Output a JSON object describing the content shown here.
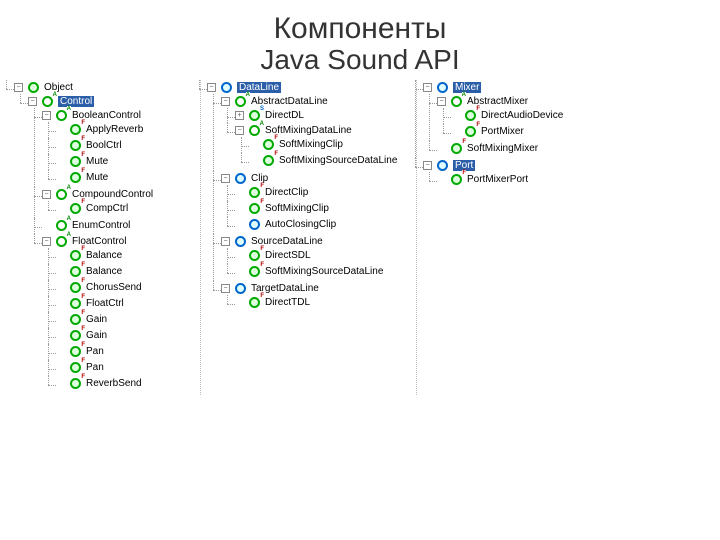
{
  "title": {
    "line1": "Компоненты",
    "line2": "Java Sound API"
  },
  "trees": [
    {
      "id": "col1",
      "root": {
        "label": "Object",
        "icon": "class",
        "toggle": "minus",
        "children": [
          {
            "label": "Control",
            "icon": "class-abstract",
            "badge": "A",
            "selected": true,
            "toggle": "minus",
            "children": [
              {
                "label": "BooleanControl",
                "icon": "class-abstract",
                "badge": "A",
                "toggle": "minus",
                "children": [
                  {
                    "label": "ApplyReverb",
                    "icon": "class",
                    "badge": "F"
                  },
                  {
                    "label": "BoolCtrl",
                    "icon": "class",
                    "badge": "F"
                  },
                  {
                    "label": "Mute",
                    "icon": "class",
                    "badge": "F"
                  },
                  {
                    "label": "Mute",
                    "icon": "class",
                    "badge": "F"
                  }
                ]
              },
              {
                "label": "CompoundControl",
                "icon": "class-abstract",
                "badge": "A",
                "toggle": "minus",
                "children": [
                  {
                    "label": "CompCtrl",
                    "icon": "class",
                    "badge": "F"
                  }
                ]
              },
              {
                "label": "EnumControl",
                "icon": "class-abstract",
                "badge": "A"
              },
              {
                "label": "FloatControl",
                "icon": "class-abstract",
                "badge": "A",
                "toggle": "minus",
                "children": [
                  {
                    "label": "Balance",
                    "icon": "class",
                    "badge": "F"
                  },
                  {
                    "label": "Balance",
                    "icon": "class",
                    "badge": "F"
                  },
                  {
                    "label": "ChorusSend",
                    "icon": "class",
                    "badge": "F"
                  },
                  {
                    "label": "FloatCtrl",
                    "icon": "class",
                    "badge": "F"
                  },
                  {
                    "label": "Gain",
                    "icon": "class",
                    "badge": "F"
                  },
                  {
                    "label": "Gain",
                    "icon": "class",
                    "badge": "F"
                  },
                  {
                    "label": "Pan",
                    "icon": "class",
                    "badge": "F"
                  },
                  {
                    "label": "Pan",
                    "icon": "class",
                    "badge": "F"
                  },
                  {
                    "label": "ReverbSend",
                    "icon": "class",
                    "badge": "F"
                  }
                ]
              }
            ]
          }
        ]
      }
    },
    {
      "id": "col2",
      "root": {
        "label": "DataLine",
        "icon": "interface",
        "selected": true,
        "toggle": "minus",
        "children": [
          {
            "label": "AbstractDataLine",
            "icon": "class-abstract",
            "badge": "A",
            "toggle": "minus",
            "children": [
              {
                "label": "DirectDL",
                "icon": "class",
                "badge": "S",
                "toggle": "plus"
              },
              {
                "label": "SoftMixingDataLine",
                "icon": "class-abstract",
                "badge": "A",
                "toggle": "minus",
                "children": [
                  {
                    "label": "SoftMixingClip",
                    "icon": "class",
                    "badge": "F"
                  },
                  {
                    "label": "SoftMixingSourceDataLine",
                    "icon": "class",
                    "badge": "F"
                  }
                ]
              }
            ]
          },
          {
            "label": "Clip",
            "icon": "interface",
            "toggle": "minus",
            "children": [
              {
                "label": "DirectClip",
                "icon": "class",
                "badge": "F"
              },
              {
                "label": "SoftMixingClip",
                "icon": "class",
                "badge": "F"
              },
              {
                "label": "AutoClosingClip",
                "icon": "interface"
              }
            ]
          },
          {
            "label": "SourceDataLine",
            "icon": "interface",
            "toggle": "minus",
            "children": [
              {
                "label": "DirectSDL",
                "icon": "class",
                "badge": "F"
              },
              {
                "label": "SoftMixingSourceDataLine",
                "icon": "class",
                "badge": "F"
              }
            ]
          },
          {
            "label": "TargetDataLine",
            "icon": "interface",
            "toggle": "minus",
            "children": [
              {
                "label": "DirectTDL",
                "icon": "class",
                "badge": "F"
              }
            ]
          }
        ]
      }
    },
    {
      "id": "col3",
      "roots": [
        {
          "label": "Mixer",
          "icon": "interface",
          "selected": true,
          "toggle": "minus",
          "children": [
            {
              "label": "AbstractMixer",
              "icon": "class-abstract",
              "badge": "A",
              "toggle": "minus",
              "children": [
                {
                  "label": "DirectAudioDevice",
                  "icon": "class",
                  "badge": "F"
                },
                {
                  "label": "PortMixer",
                  "icon": "class",
                  "badge": "F"
                }
              ]
            },
            {
              "label": "SoftMixingMixer",
              "icon": "class",
              "badge": "F"
            }
          ]
        },
        {
          "label": "Port",
          "icon": "interface",
          "selected": true,
          "toggle": "minus",
          "children": [
            {
              "label": "PortMixerPort",
              "icon": "class",
              "badge": "F"
            }
          ]
        }
      ]
    }
  ]
}
